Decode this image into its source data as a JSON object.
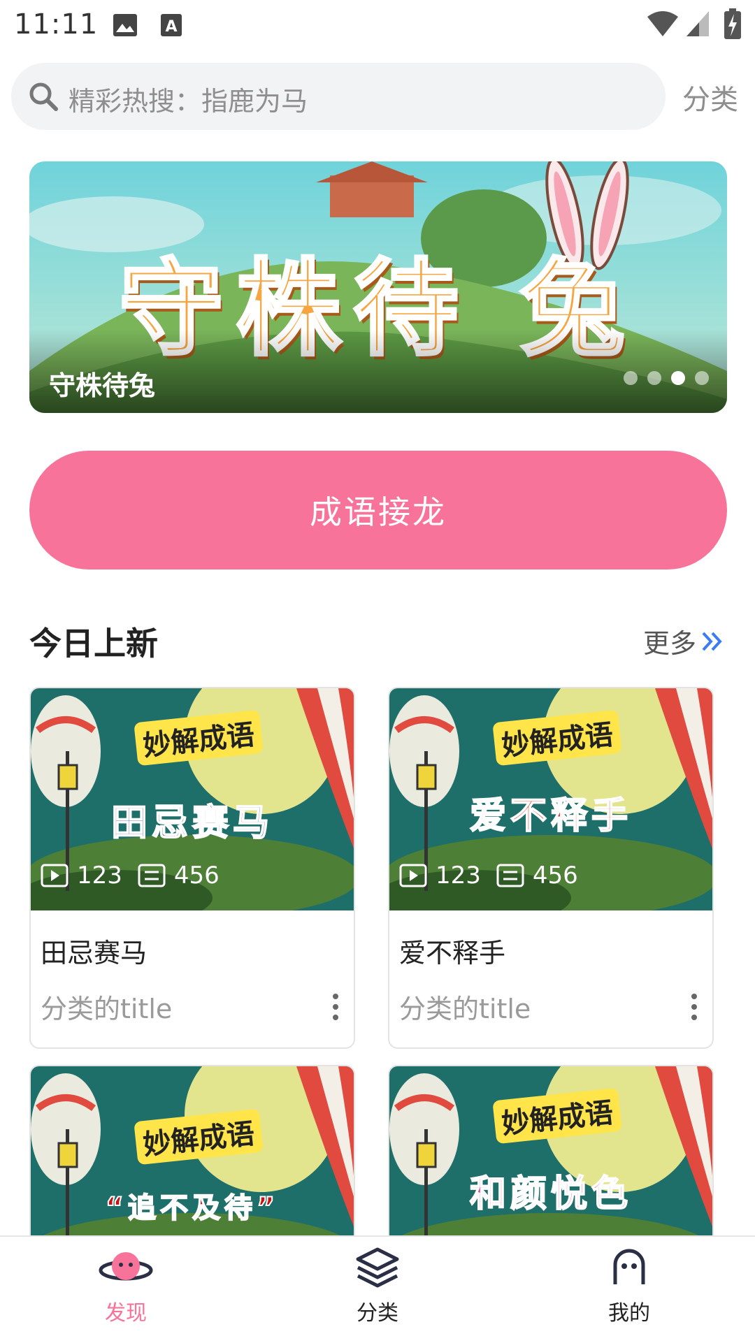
{
  "status_bar": {
    "time": "11:11"
  },
  "search": {
    "placeholder": "精彩热搜：指鹿为马"
  },
  "header": {
    "category_link": "分类"
  },
  "banner": {
    "art_title": "守株待 兔",
    "caption": "守株待兔",
    "dots": 4,
    "active_dot": 3
  },
  "main_button": {
    "label": "成语接龙"
  },
  "section": {
    "title": "今日上新",
    "more_label": "更多"
  },
  "cards": [
    {
      "thumb_brand": "妙解成语",
      "thumb_title": "田忌赛马",
      "plays": "123",
      "episodes": "456",
      "title": "田忌赛马",
      "subtitle": "分类的title",
      "title_color": "#1d3f8f"
    },
    {
      "thumb_brand": "妙解成语",
      "thumb_title": "爱不释手",
      "plays": "123",
      "episodes": "456",
      "title": "爱不释手",
      "subtitle": "分类的title",
      "title_color": "#d9351c"
    },
    {
      "thumb_brand": "妙解成语",
      "thumb_title": "“追不及待”",
      "title_color": "#c21414"
    },
    {
      "thumb_brand": "妙解成语",
      "thumb_title": "和颜悦色",
      "title_color": "#e0459a"
    }
  ],
  "bottom_nav": [
    {
      "label": "发现",
      "icon": "planet-icon",
      "active": true
    },
    {
      "label": "分类",
      "icon": "layers-icon",
      "active": false
    },
    {
      "label": "我的",
      "icon": "profile-icon",
      "active": false
    }
  ],
  "colors": {
    "accent": "#f7739a",
    "nav_active": "#f7739a",
    "link_blue": "#3b7cf5"
  }
}
